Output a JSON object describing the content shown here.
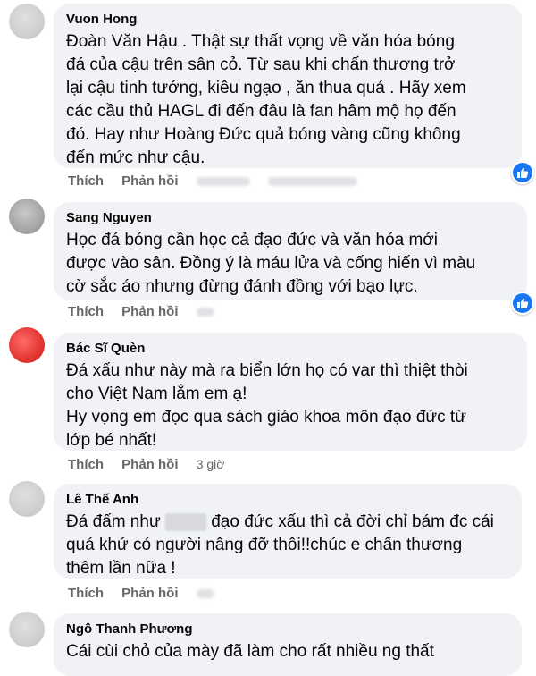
{
  "actions": {
    "like": "Thích",
    "reply": "Phản hồi"
  },
  "comments": [
    {
      "name": "Vuon Hong",
      "lines": [
        "Đoàn Văn Hậu . Thật sự thất vọng về văn hóa bóng",
        "đá của cậu trên sân cỏ. Từ sau khi chấn thương trở",
        "lại cậu tinh tướng, kiêu ngạo , ăn thua quá . Hãy xem",
        "các cầu thủ HAGL đi đến đâu là fan hâm mộ họ đến",
        "đó. Hay như Hoàng Đức quả bóng vàng cũng không",
        "đến mức như cậu."
      ],
      "reaction": "like-icon"
    },
    {
      "name": "Sang Nguyen",
      "lines": [
        "Học đá bóng cần học cả đạo đức và văn hóa mới",
        "được vào sân. Đồng ý là máu lửa và cống hiến vì màu",
        "cờ sắc áo nhưng đừng đánh đồng với bạo lực."
      ],
      "reaction": "like-icon"
    },
    {
      "name": "Bác Sĩ Quèn",
      "lines": [
        "Đá xấu như này mà ra biển lớn họ có var thì thiệt thòi",
        "cho Việt Nam lắm em ạ!",
        "Hy vọng em đọc qua sách giáo khoa môn đạo đức từ",
        "lớp bé nhất!"
      ],
      "time": "3 giờ"
    },
    {
      "name": "Lê Thế Anh",
      "line1_before": "Đá đấm như",
      "line1_after": "đạo đức xấu thì cả đời chỉ bám đc cái",
      "lines": [
        "quá khứ có người nâng đỡ thôi!!chúc e chấn thương",
        "thêm lần nữa !"
      ]
    },
    {
      "name": "Ngô Thanh Phương",
      "lines": [
        "Cái cùi chỏ của mày đã làm cho rất nhiều ng thất"
      ]
    }
  ]
}
